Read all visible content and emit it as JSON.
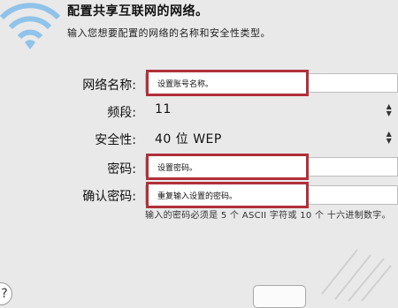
{
  "dialog": {
    "title": "配置共享互联网的网络。",
    "subtitle": "输入您想要配置的网络的名称和安全性类型。"
  },
  "form": {
    "network_name_label": "网络名称:",
    "network_name_value": "设置账号名称。",
    "channel_label": "频段:",
    "channel_value": "11",
    "security_label": "安全性:",
    "security_value": "40 位 WEP",
    "password_label": "密码:",
    "password_value": "设置密码。",
    "confirm_label": "确认密码:",
    "confirm_value": "重复输入设置的密码。",
    "hint": "输入的密码必须是 5 个 ASCII 字符或 10 个 十六进制数字。"
  },
  "buttons": {
    "help": "?"
  },
  "colors": {
    "highlight": "#b0303a",
    "wifi_icon": "#8fc3ea",
    "background": "#e9e9e9"
  },
  "icons": {
    "network": "wifi-icon",
    "help": "help-icon",
    "stepper": "up-down-arrows-icon"
  }
}
